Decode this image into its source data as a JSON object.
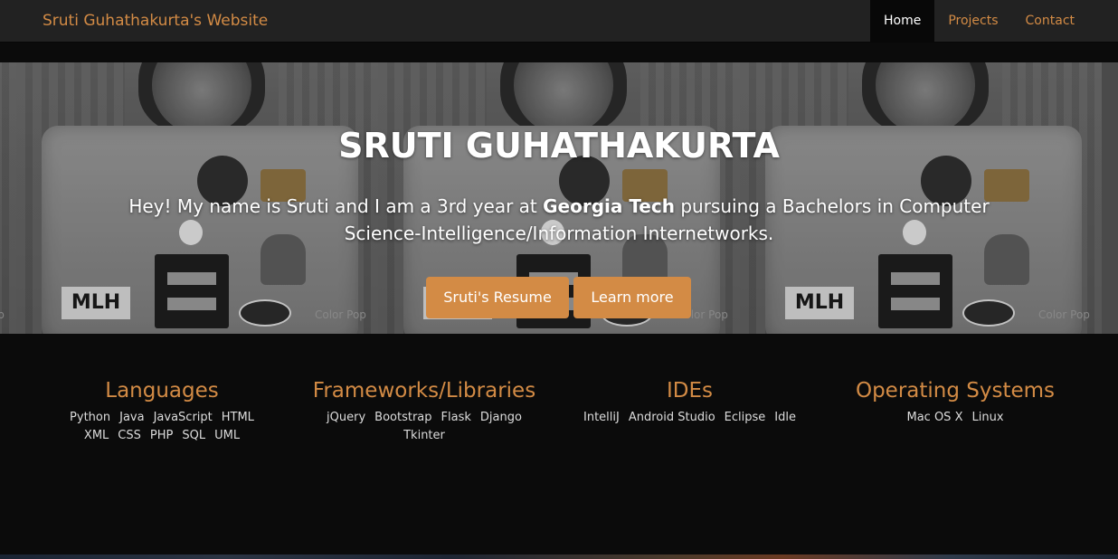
{
  "navbar": {
    "brand": "Sruti Guhathakurta's Website",
    "items": [
      {
        "label": "Home",
        "active": true
      },
      {
        "label": "Projects",
        "active": false
      },
      {
        "label": "Contact",
        "active": false
      }
    ]
  },
  "hero": {
    "title": "SRUTI GUHATHAKURTA",
    "intro_before": "Hey! My name is Sruti and I am a 3rd year at ",
    "intro_bold": "Georgia Tech",
    "intro_after": " pursuing a Bachelors in Computer Science-Intelligence/Information Internetworks.",
    "buttons": {
      "resume": "Sruti's Resume",
      "learn_more": "Learn more"
    },
    "image_watermark": "Color Pop",
    "sticker_text": "MLH"
  },
  "skills": [
    {
      "heading": "Languages",
      "items": [
        "Python",
        "Java",
        "JavaScript",
        "HTML",
        "XML",
        "CSS",
        "PHP",
        "SQL",
        "UML"
      ]
    },
    {
      "heading": "Frameworks/Libraries",
      "items": [
        "jQuery",
        "Bootstrap",
        "Flask",
        "Django",
        "Tkinter"
      ]
    },
    {
      "heading": "IDEs",
      "items": [
        "IntelliJ",
        "Android Studio",
        "Eclipse",
        "Idle"
      ]
    },
    {
      "heading": "Operating Systems",
      "items": [
        "Mac OS X",
        "Linux"
      ]
    }
  ],
  "colors": {
    "accent": "#d38b45",
    "navbar_bg": "#222222",
    "page_bg": "#0b0b0b",
    "text_light": "#dcdcdc"
  }
}
